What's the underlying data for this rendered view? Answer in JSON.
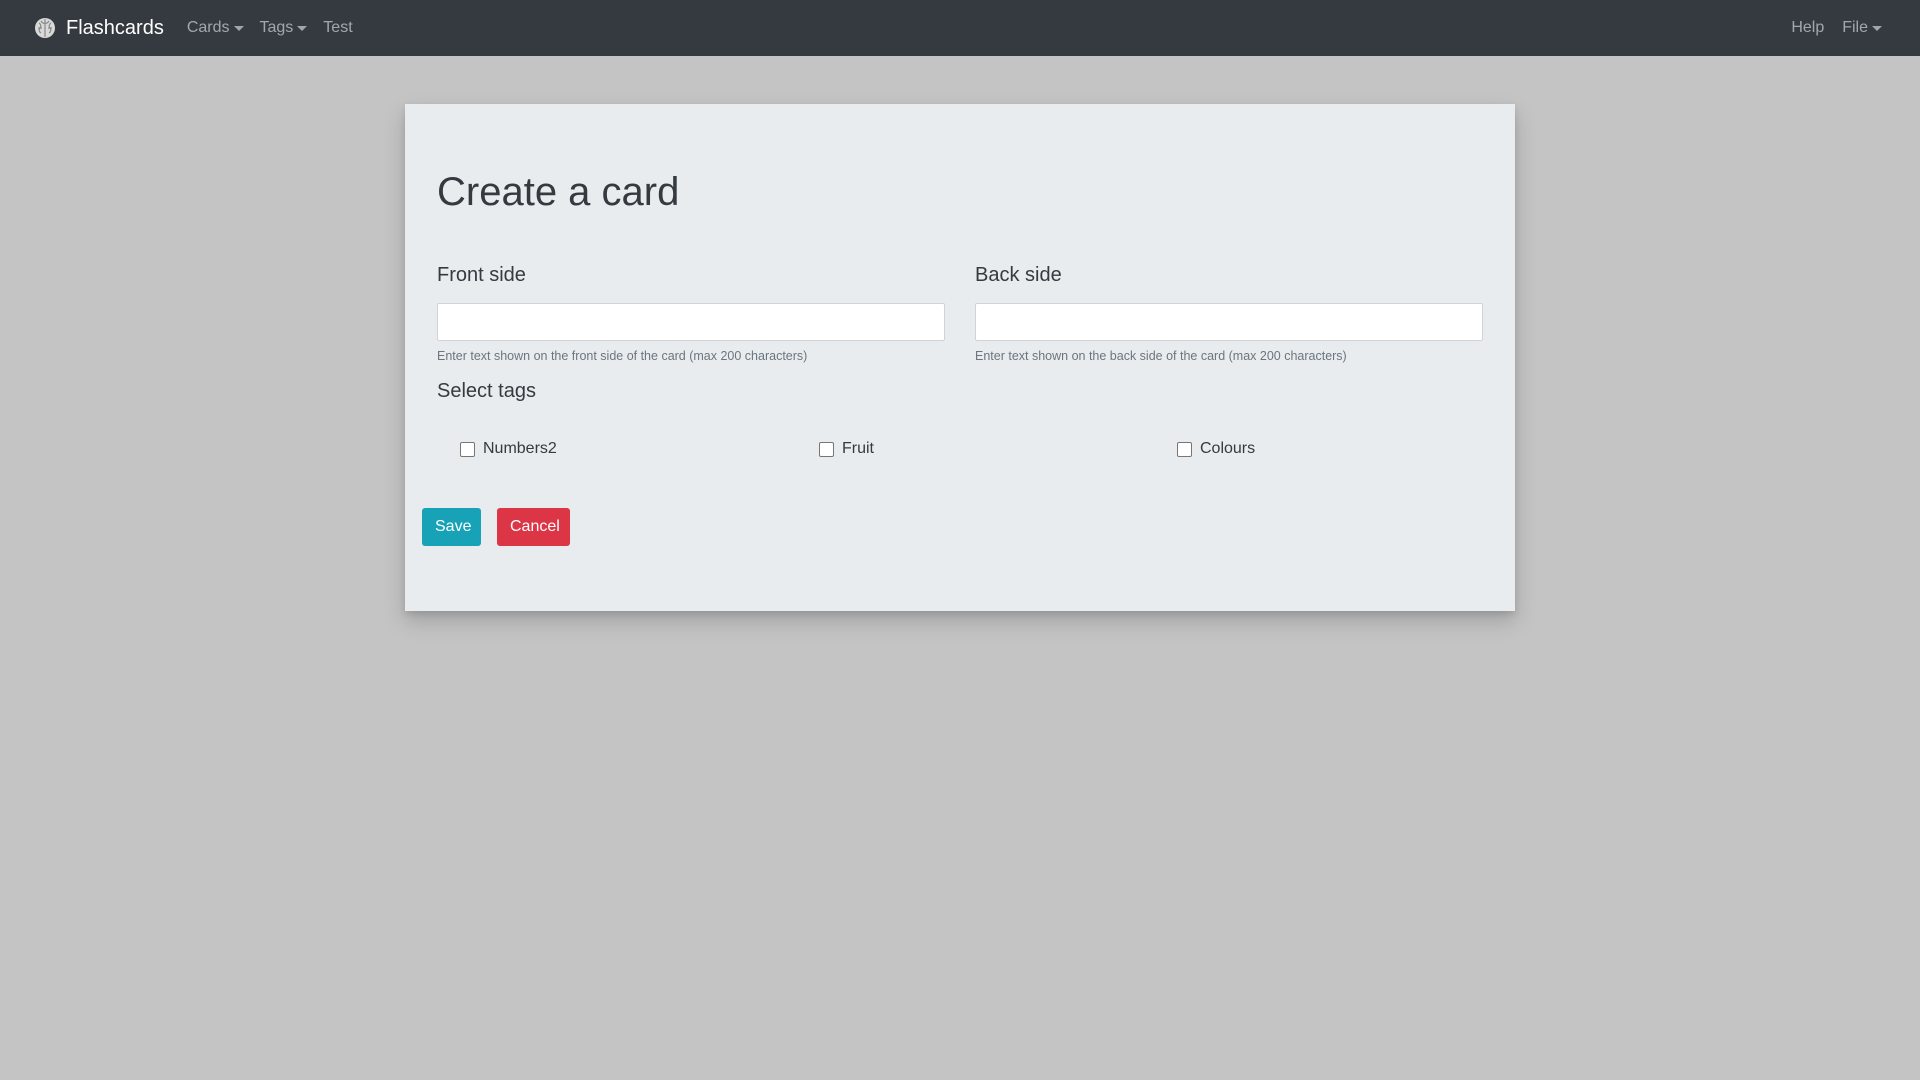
{
  "navbar": {
    "brand": "Flashcards",
    "brand_icon": "brain-icon",
    "left_items": [
      {
        "label": "Cards",
        "dropdown": true
      },
      {
        "label": "Tags",
        "dropdown": true
      },
      {
        "label": "Test",
        "dropdown": false
      }
    ],
    "right_items": [
      {
        "label": "Help",
        "dropdown": false
      },
      {
        "label": "File",
        "dropdown": true
      }
    ]
  },
  "form": {
    "title": "Create a card",
    "front": {
      "label": "Front side",
      "value": "",
      "help": "Enter text shown on the front side of the card (max 200 characters)"
    },
    "back": {
      "label": "Back side",
      "value": "",
      "help": "Enter text shown on the back side of the card (max 200 characters)"
    },
    "tags_label": "Select tags",
    "tags": [
      {
        "label": "Numbers2",
        "checked": false
      },
      {
        "label": "Fruit",
        "checked": false
      },
      {
        "label": "Colours",
        "checked": false
      }
    ],
    "save_label": "Save",
    "cancel_label": "Cancel"
  },
  "colors": {
    "navbar_bg": "#343a40",
    "page_bg": "#c4c4c4",
    "panel_bg": "#e8ecef",
    "save_button": "#17a2b8",
    "cancel_button": "#dc3545"
  }
}
